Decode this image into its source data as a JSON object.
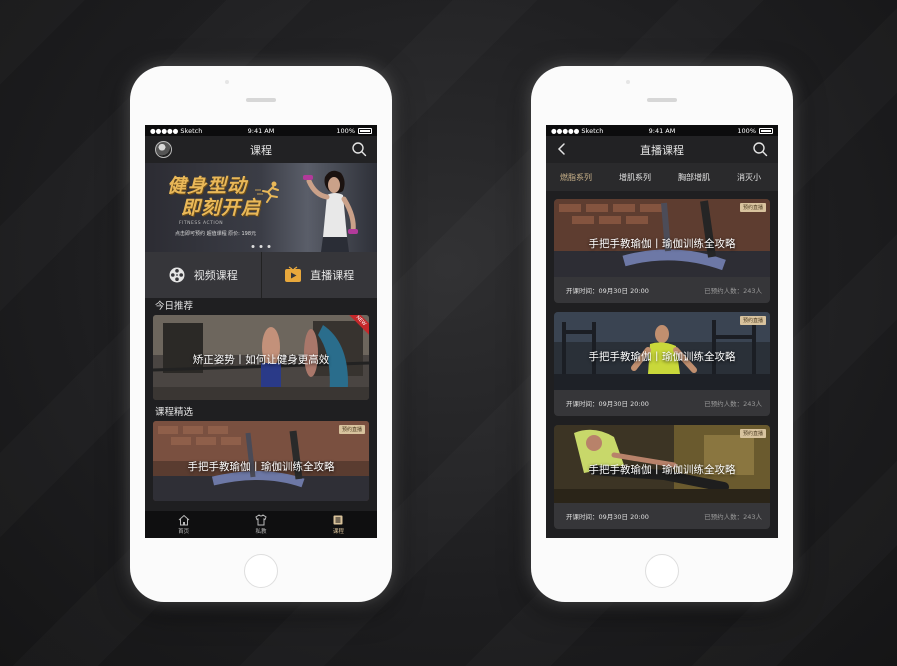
{
  "statusbar": {
    "carrier": "●●●●● Sketch",
    "time": "9:41 AM",
    "battery": "100%"
  },
  "left": {
    "nav_title": "课程",
    "banner": {
      "line1": "健身型动",
      "line2": "即刻开启",
      "sub": "FITNESS ACTION",
      "price": "点击即可预约 超值课程 原价: 198元"
    },
    "entries": [
      {
        "label": "视频课程",
        "icon": "film-reel-icon"
      },
      {
        "label": "直播课程",
        "icon": "play-icon"
      }
    ],
    "today_title": "今日推荐",
    "today_card": {
      "text": "矫正姿势丨如何让健身更高效",
      "ribbon": "NEW"
    },
    "featured_title": "课程精选",
    "featured_card": {
      "text": "手把手教瑜伽丨瑜伽训练全攻略",
      "tag": "预约直播"
    },
    "tabs": [
      {
        "label": "首页",
        "icon": "home-icon"
      },
      {
        "label": "私教",
        "icon": "shirt-icon"
      },
      {
        "label": "课程",
        "icon": "list-icon"
      }
    ]
  },
  "right": {
    "nav_title": "直播课程",
    "seg_tabs": [
      "燃脂系列",
      "增肌系列",
      "胸部增肌",
      "消灭小"
    ],
    "cards": [
      {
        "text": "手把手教瑜伽丨瑜伽训练全攻略",
        "tag": "预约直播",
        "time": "开课时间：09月30日 20:00",
        "count": "已预约人数：243人"
      },
      {
        "text": "手把手教瑜伽丨瑜伽训练全攻略",
        "tag": "预约直播",
        "time": "开课时间：09月30日 20:00",
        "count": "已预约人数：243人"
      },
      {
        "text": "手把手教瑜伽丨瑜伽训练全攻略",
        "tag": "预约直播",
        "time": "开课时间：09月30日 20:00",
        "count": "已预约人数：243人"
      }
    ]
  },
  "colors": {
    "accent": "#d9c29a",
    "banner_title": "#e9b858",
    "ribbon": "#c5282b"
  }
}
